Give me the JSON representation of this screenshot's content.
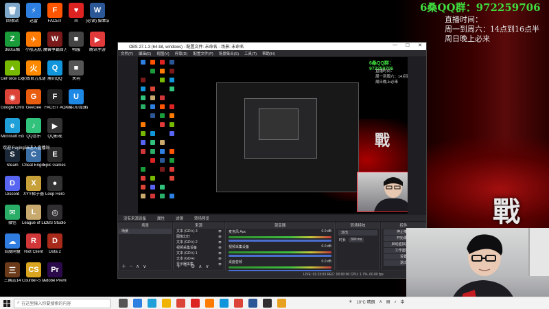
{
  "overlay": {
    "qq_group": "6桑QQ群：972259706",
    "line1": "直播时间：",
    "line2": "周一到周六：14点到16点半",
    "line3": "周日晚上必来"
  },
  "desktop_big_char": "戰",
  "desktop_icons": [
    {
      "label": "回收站",
      "color": "#7fa7c9",
      "glyph": "🗑",
      "col": 0,
      "row": 0
    },
    {
      "label": "迅雷",
      "color": "#2d7fe0",
      "glyph": "⚡",
      "col": 1,
      "row": 0
    },
    {
      "label": "FACEIT",
      "color": "#ff5500",
      "glyph": "F",
      "col": 2,
      "row": 0
    },
    {
      "label": "rn",
      "color": "#d22",
      "glyph": "♥",
      "col": 3,
      "row": 0
    },
    {
      "label": "(必读) 脚本说明",
      "color": "#2b5797",
      "glyph": "W",
      "col": 4,
      "row": 0
    },
    {
      "label": "360压缩",
      "color": "#1a9c3b",
      "glyph": "Z",
      "col": 0,
      "row": 1
    },
    {
      "label": "小航无机",
      "color": "#ff7a00",
      "glyph": "✈",
      "col": 1,
      "row": 1
    },
    {
      "label": "魔兽争霸官方对战平台",
      "color": "#7a1a1a",
      "glyph": "W",
      "col": 2,
      "row": 1
    },
    {
      "label": "韩服",
      "color": "#444",
      "glyph": "■",
      "col": 3,
      "row": 1
    },
    {
      "label": "腾讯手游",
      "color": "#e03a3a",
      "glyph": "▶",
      "col": 4,
      "row": 1
    },
    {
      "label": "GeForce Experience",
      "color": "#76b900",
      "glyph": "▲",
      "col": 0,
      "row": 2
    },
    {
      "label": "火线官方加速器",
      "color": "#ff8a00",
      "glyph": "火",
      "col": 1,
      "row": 2
    },
    {
      "label": "腾讯QQ",
      "color": "#1296db",
      "glyph": "Q",
      "col": 2,
      "row": 2
    },
    {
      "label": "关羽",
      "color": "#555",
      "glyph": "■",
      "col": 3,
      "row": 2
    },
    {
      "label": "Google Chrome",
      "color": "#db4437",
      "glyph": "◉",
      "col": 0,
      "row": 3
    },
    {
      "label": "GeeGee",
      "color": "#e85d10",
      "glyph": "G",
      "col": 1,
      "row": 3
    },
    {
      "label": "FACEIT AC",
      "color": "#222",
      "glyph": "F",
      "col": 2,
      "row": 3
    },
    {
      "label": "网易UU加速器",
      "color": "#1e88e5",
      "glyph": "U",
      "col": 3,
      "row": 3
    },
    {
      "label": "Microsoft Edge",
      "color": "#1fa0d8",
      "glyph": "e",
      "col": 0,
      "row": 4
    },
    {
      "label": "QQ音乐",
      "color": "#31c27c",
      "glyph": "♪",
      "col": 1,
      "row": 4
    },
    {
      "label": "QQ影视",
      "color": "#333",
      "glyph": "▶",
      "col": 2,
      "row": 4
    },
    {
      "label": "Steam",
      "color": "#1b2838",
      "glyph": "S",
      "col": 0,
      "row": 5
    },
    {
      "label": "Cheat Engine",
      "color": "#3a6ea5",
      "glyph": "C",
      "col": 1,
      "row": 5
    },
    {
      "label": "Epic Games Launcher",
      "color": "#2a2a2a",
      "glyph": "E",
      "col": 2,
      "row": 5
    },
    {
      "label": "Discord",
      "color": "#5865f2",
      "glyph": "D",
      "col": 0,
      "row": 6
    },
    {
      "label": "XYY梯子器",
      "color": "#c8a03a",
      "glyph": "X",
      "col": 1,
      "row": 6
    },
    {
      "label": "Loop Hero",
      "color": "#333",
      "glyph": "●",
      "col": 2,
      "row": 6
    },
    {
      "label": "微信",
      "color": "#2aae67",
      "glyph": "✉",
      "col": 0,
      "row": 7
    },
    {
      "label": "League of Legends",
      "color": "#c8aa6e",
      "glyph": "L",
      "col": 1,
      "row": 7
    },
    {
      "label": "OBS Studio",
      "color": "#302e31",
      "glyph": "◎",
      "col": 2,
      "row": 7
    },
    {
      "label": "百度网盘",
      "color": "#2f7de1",
      "glyph": "☁",
      "col": 0,
      "row": 8
    },
    {
      "label": "Riot Client",
      "color": "#d13639",
      "glyph": "R",
      "col": 1,
      "row": 8
    },
    {
      "label": "Dota 2",
      "color": "#a82a1a",
      "glyph": "D",
      "col": 2,
      "row": 8
    },
    {
      "label": "三国志14",
      "color": "#6a3a1a",
      "glyph": "三",
      "col": 0,
      "row": 9
    },
    {
      "label": "Counter-S Global Off...",
      "color": "#d9a520",
      "glyph": "CS",
      "col": 1,
      "row": 9
    },
    {
      "label": "Adobe Premie...",
      "color": "#2a0a4a",
      "glyph": "Pr",
      "col": 2,
      "row": 9
    }
  ],
  "desktop_notice": "欢迎 Fuying56进入直播间",
  "obs": {
    "title": "OBS 27.1.3 (64-bit, windows) - 配置文件: 未命名 - 场景: 未命名",
    "menu": [
      "文件(F)",
      "编辑(E)",
      "视图(V)",
      "停靠(D)",
      "配置文件(P)",
      "场景集合(S)",
      "工具(T)",
      "帮助(H)"
    ],
    "dock_tabs": [
      "没有来源设备",
      "属性",
      "滤镜",
      "转场预览"
    ],
    "scenes_header": "场景",
    "scenes": [
      "场景"
    ],
    "sources_header": "来源",
    "sources": [
      "文本 (GDI+) 3",
      "图像幻灯",
      "文本 (GDI+) 2",
      "视频采集设备",
      "文本 (GDI+) 1",
      "文本 (GDI+)",
      "显示器采集"
    ],
    "mixer_header": "混音器",
    "mixer": [
      {
        "name": "麦克风 Aux",
        "value": "0.0 dB"
      },
      {
        "name": "视频采集设备",
        "value": "0.0 dB"
      },
      {
        "name": "桌面音频",
        "value": "0.0 dB"
      }
    ],
    "transition_header": "转场特效",
    "transition": {
      "type": "淡出",
      "duration_label": "时长",
      "duration": "300 ms"
    },
    "controls_header": "控件",
    "controls": [
      "停止推流",
      "开始录制",
      "启动虚拟摄像机",
      "工作室模式",
      "设置",
      "退出"
    ],
    "status": "LIVE: 01:23:03  REC: 00:00:00  CPU: 1.7%, 60.00 fps",
    "preview": {
      "qq_group": "6桑QQ群：972259706",
      "line1": "直播时间：",
      "line2": "周一到周六：14点到16点半",
      "line3": "周日晚上必来",
      "big_char": "戰"
    }
  },
  "taskbar": {
    "search_placeholder": "在这里输入你要搜索的内容",
    "weather": "10°C 晴朗",
    "lang": "中"
  }
}
